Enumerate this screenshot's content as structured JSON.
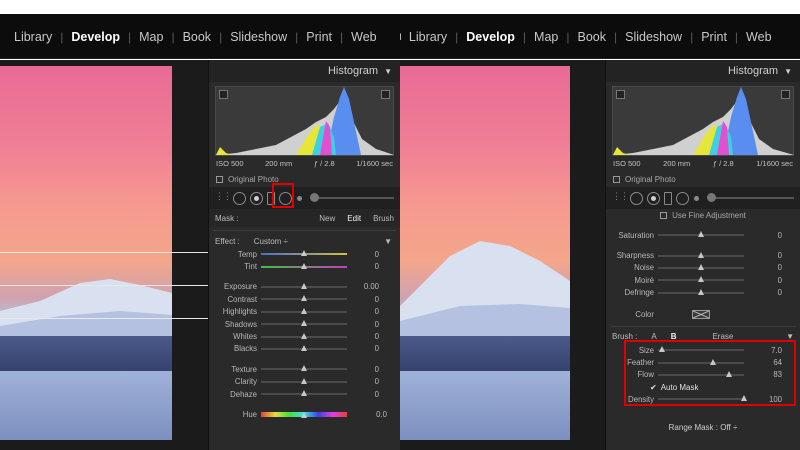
{
  "left": {
    "modules": [
      "Library",
      "Develop",
      "Map",
      "Book",
      "Slideshow",
      "Print",
      "Web"
    ],
    "active_module": "Develop",
    "histogram": {
      "header": "Histogram"
    },
    "exif": {
      "iso": "ISO 500",
      "focal": "200 mm",
      "aperture": "ƒ / 2.8",
      "shutter": "1/1600 sec"
    },
    "original_photo": "Original Photo",
    "mask": {
      "label": "Mask :",
      "new": "New",
      "edit": "Edit",
      "brush": "Brush"
    },
    "effect": {
      "label": "Effect :",
      "value": "Custom ÷"
    },
    "sliders_a": [
      {
        "label": "Temp",
        "value": "0",
        "pos": 0.5
      },
      {
        "label": "Tint",
        "value": "0",
        "pos": 0.5
      }
    ],
    "sliders_b": [
      {
        "label": "Exposure",
        "value": "0.00",
        "pos": 0.5
      },
      {
        "label": "Contrast",
        "value": "0",
        "pos": 0.5
      },
      {
        "label": "Highlights",
        "value": "0",
        "pos": 0.5
      },
      {
        "label": "Shadows",
        "value": "0",
        "pos": 0.5
      },
      {
        "label": "Whites",
        "value": "0",
        "pos": 0.5
      },
      {
        "label": "Blacks",
        "value": "0",
        "pos": 0.5
      }
    ],
    "sliders_c": [
      {
        "label": "Texture",
        "value": "0",
        "pos": 0.5
      },
      {
        "label": "Clarity",
        "value": "0",
        "pos": 0.5
      },
      {
        "label": "Dehaze",
        "value": "0",
        "pos": 0.5
      }
    ],
    "hue": {
      "label": "Hue",
      "value": "0.0",
      "pos": 0.5
    }
  },
  "right": {
    "modules": [
      "Library",
      "Develop",
      "Map",
      "Book",
      "Slideshow",
      "Print",
      "Web"
    ],
    "active_module": "Develop",
    "histogram": {
      "header": "Histogram"
    },
    "exif": {
      "iso": "ISO 500",
      "focal": "200 mm",
      "aperture": "ƒ / 2.8",
      "shutter": "1/1600 sec"
    },
    "original_photo": "Original Photo",
    "fine_adjust": "Use Fine Adjustment",
    "sliders_a": [
      {
        "label": "Saturation",
        "value": "0",
        "pos": 0.5
      }
    ],
    "sliders_b": [
      {
        "label": "Sharpness",
        "value": "0",
        "pos": 0.5
      },
      {
        "label": "Noise",
        "value": "0",
        "pos": 0.5
      },
      {
        "label": "Moiré",
        "value": "0",
        "pos": 0.5
      },
      {
        "label": "Defringe",
        "value": "0",
        "pos": 0.5
      }
    ],
    "color_label": "Color",
    "brush": {
      "label": "Brush :",
      "a": "A",
      "b": "B",
      "erase": "Erase"
    },
    "brush_sliders": [
      {
        "label": "Size",
        "value": "7.0",
        "pos": 0.05
      },
      {
        "label": "Feather",
        "value": "64",
        "pos": 0.64
      },
      {
        "label": "Flow",
        "value": "83",
        "pos": 0.83
      }
    ],
    "auto_mask": "Auto Mask",
    "density": {
      "label": "Density",
      "value": "100",
      "pos": 1.0
    },
    "range_mask": "Range Mask : Off ÷"
  }
}
